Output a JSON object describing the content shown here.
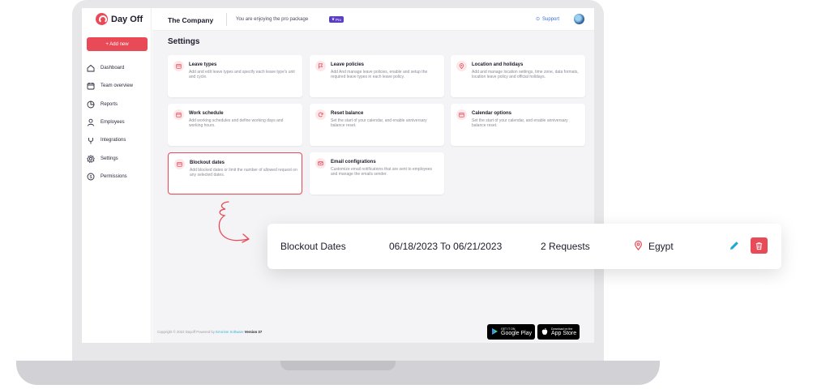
{
  "app": {
    "name": "Day Off"
  },
  "sidebar": {
    "add_label": "+ Add new",
    "items": [
      {
        "label": "Dashboard",
        "icon": "home-icon"
      },
      {
        "label": "Team overview",
        "icon": "calendar-icon"
      },
      {
        "label": "Reports",
        "icon": "pie-chart-icon"
      },
      {
        "label": "Employees",
        "icon": "user-icon"
      },
      {
        "label": "Integrations",
        "icon": "plug-icon"
      },
      {
        "label": "Settings",
        "icon": "gear-icon"
      },
      {
        "label": "Permissions",
        "icon": "dollar-icon"
      }
    ]
  },
  "topbar": {
    "company": "The Company",
    "pro_text": "You are enjoying the pro package",
    "pro_badge": "Pro",
    "support": "Support"
  },
  "page": {
    "title": "Settings"
  },
  "cards": [
    {
      "title": "Leave types",
      "desc": "Add and edit leave types and specify each leave type's unit and cycle.",
      "icon": "calendar-icon"
    },
    {
      "title": "Leave policies",
      "desc": "Add And manage leave policies, enable and setup the required leave types in each leave policy.",
      "icon": "flag-icon"
    },
    {
      "title": "Location and holidays",
      "desc": "Add and manage location settings, time zone, data formats, location leave policy and official holidays.",
      "icon": "location-pin-icon"
    },
    {
      "title": "Work schedule",
      "desc": "Add working schedules and define working days and working hours.",
      "icon": "calendar-icon"
    },
    {
      "title": "Reset balance",
      "desc": "Set the start of your calendar, and enable anniversary balance reset.",
      "icon": "refresh-icon"
    },
    {
      "title": "Calendar options",
      "desc": "Set the start of your calendar, and enable anniversary balance reset.",
      "icon": "calendar-icon"
    },
    {
      "title": "Blockout dates",
      "desc": "Add blocked dates or limit the number of allowed request on any selected dates.",
      "icon": "calendar-icon"
    },
    {
      "title": "Email configrations",
      "desc": "Customize email notifications that are sent to employees and manage the emails sender.",
      "icon": "mail-icon"
    }
  ],
  "footer": {
    "copyright": "Copyright © 2022 Dayoff  Powered by",
    "powered_link": "Errorism Software",
    "version_label": "Version 37"
  },
  "stores": {
    "google_small": "GET IT ON",
    "google_big": "Google Play",
    "apple_small": "Download on the",
    "apple_big": "App Store"
  },
  "popup": {
    "type": "Blockout Dates",
    "dates": "06/18/2023 To 06/21/2023",
    "requests": "2 Requests",
    "location": "Egypt"
  },
  "colors": {
    "accent": "#e94a57",
    "pro": "#5a3fc0",
    "link": "#3a6fd8",
    "edit": "#1ba8d8"
  }
}
